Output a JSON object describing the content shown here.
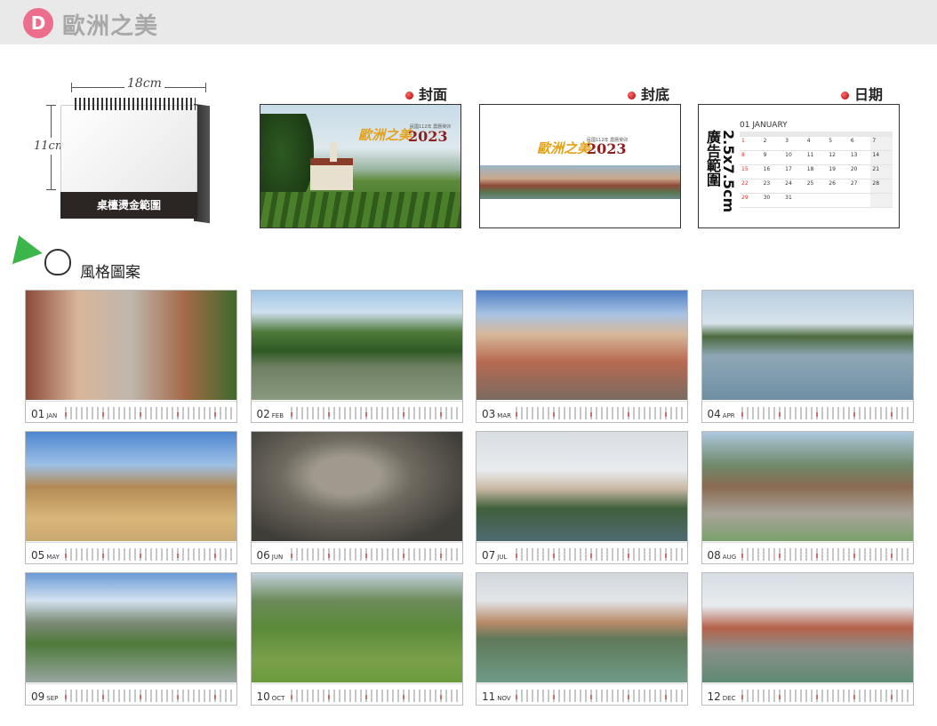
{
  "header": {
    "badge": "D",
    "title": "歐洲之美"
  },
  "desk": {
    "width_label": "18cm",
    "height_label": "11cm",
    "base_label": "桌檯燙金範圍"
  },
  "previews": [
    {
      "label": "封面"
    },
    {
      "label": "封底"
    },
    {
      "label": "日期"
    }
  ],
  "brand": {
    "name": "歐洲之美",
    "year": "2023",
    "subtitle": "民國112年 農曆癸卯"
  },
  "date_card": {
    "month": "01 JANUARY",
    "ad_label": "2.5x7.5cm 廣告範圍",
    "days": [
      "1",
      "2",
      "3",
      "4",
      "5",
      "6",
      "7",
      "8",
      "9",
      "10",
      "11",
      "12",
      "13",
      "14",
      "15",
      "16",
      "17",
      "18",
      "19",
      "20",
      "21",
      "22",
      "23",
      "24",
      "25",
      "26",
      "27",
      "28",
      "29",
      "30",
      "31",
      "",
      "",
      "",
      ""
    ]
  },
  "style": {
    "label": "風格圖案"
  },
  "months": [
    {
      "num": "01",
      "abbr": "JAN"
    },
    {
      "num": "02",
      "abbr": "FEB"
    },
    {
      "num": "03",
      "abbr": "MAR"
    },
    {
      "num": "04",
      "abbr": "APR"
    },
    {
      "num": "05",
      "abbr": "MAY"
    },
    {
      "num": "06",
      "abbr": "JUN"
    },
    {
      "num": "07",
      "abbr": "JUL"
    },
    {
      "num": "08",
      "abbr": "AUG"
    },
    {
      "num": "09",
      "abbr": "SEP"
    },
    {
      "num": "10",
      "abbr": "OCT"
    },
    {
      "num": "11",
      "abbr": "NOV"
    },
    {
      "num": "12",
      "abbr": "DEC"
    }
  ],
  "colors": {
    "badge": "#ec6d8c",
    "title": "#a8a8a8",
    "brand_gold": "#e3a21a",
    "brand_red": "#8f1e1e"
  }
}
